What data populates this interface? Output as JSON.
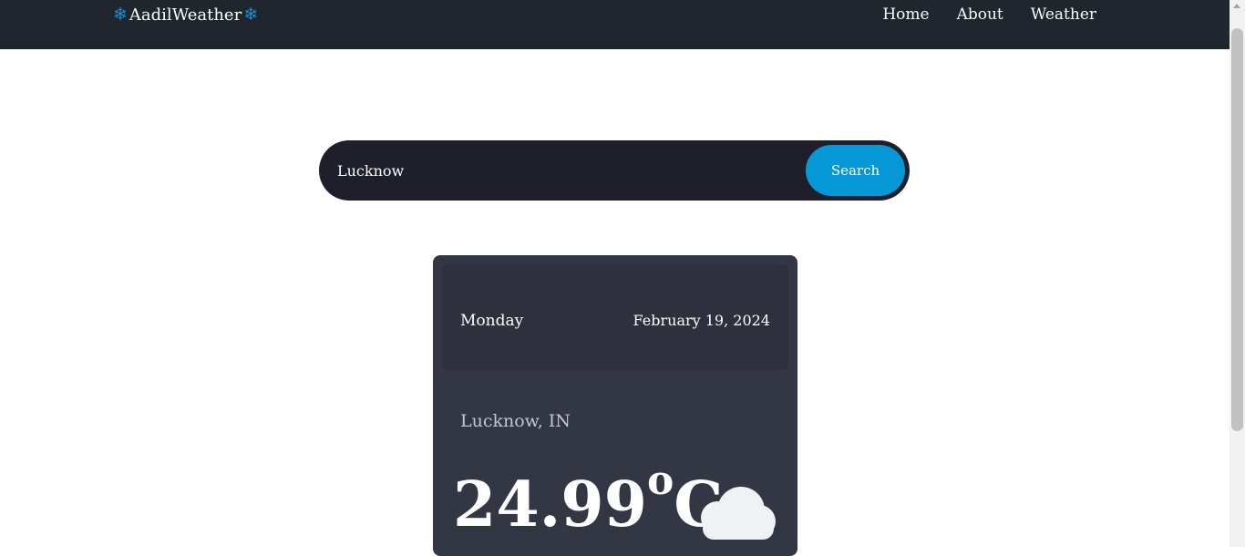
{
  "navbar": {
    "brand": {
      "icon_left": "snowflake-icon",
      "text": "AadilWeather",
      "icon_right": "snowflake-icon",
      "icon_color": "#1a8fd8"
    },
    "links": [
      {
        "label": "Home"
      },
      {
        "label": "About"
      },
      {
        "label": "Weather"
      }
    ],
    "background": "#1f262d"
  },
  "search": {
    "value": "Lucknow",
    "button_label": "Search",
    "button_color": "#0597d6"
  },
  "weather_card": {
    "day": "Monday",
    "date": "February 19, 2024",
    "location": "Lucknow, IN",
    "temperature": "24.99",
    "degree_symbol": "o",
    "unit": "C",
    "condition_icon": "cloud-icon"
  }
}
